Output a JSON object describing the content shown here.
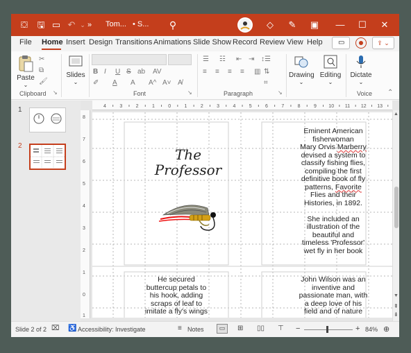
{
  "titlebar": {
    "doc_title": "Tom...",
    "save_state": "• S...",
    "more_label": "»",
    "undo_dropdown": "⌄"
  },
  "menu": {
    "tabs": [
      "File",
      "Home",
      "Insert",
      "Design",
      "Transitions",
      "Animations",
      "Slide Show",
      "Record",
      "Review",
      "View",
      "Help"
    ]
  },
  "ribbon": {
    "paste_label": "Paste",
    "slides_label": "Slides",
    "drawing_label": "Drawing",
    "editing_label": "Editing",
    "dictate_label": "Dictate",
    "groups": {
      "clipboard": "Clipboard",
      "font": "Font",
      "paragraph": "Paragraph",
      "voice": "Voice"
    },
    "font_buttons": [
      "B",
      "I",
      "U",
      "S",
      "ab",
      "AV"
    ],
    "font_size_buttons": [
      "A",
      "A",
      "A^",
      "A˅"
    ]
  },
  "ruler": {
    "labels": [
      "4",
      "3",
      "2",
      "1",
      "0",
      "1",
      "2",
      "3",
      "4",
      "5",
      "6",
      "7",
      "8",
      "9",
      "10",
      "11",
      "12",
      "13"
    ]
  },
  "thumbnails": [
    {
      "number": "1"
    },
    {
      "number": "2"
    }
  ],
  "slide": {
    "title_line1": "The",
    "title_line2": "Professor",
    "right_text_lines": [
      "Eminent American",
      "fisherwoman",
      "Mary Orvis ",
      "devised a system to",
      "classify fishing flies,",
      "compiling the first",
      "definitive book of fly",
      "patterns, ",
      "Flies and their",
      "Histories, in 1892."
    ],
    "marberry": "Marberry",
    "favorite": "Favorite",
    "right_text2_lines": [
      "She included an",
      "illustration of the",
      "beautiful and",
      "timeless 'Professor'",
      "wet fly in her book"
    ],
    "bottom_left_lines": [
      "He secured",
      "buttercup petals to",
      "his hook, adding",
      "scraps of leaf to",
      "imitate a fly's wings"
    ],
    "bottom_right_lines": [
      "John Wilson was an",
      "inventive and",
      "passionate man, with",
      "a deep love of his",
      "field and of nature"
    ]
  },
  "statusbar": {
    "slide_info": "Slide 2 of 2",
    "accessibility": "Accessibility: Investigate",
    "notes": "Notes",
    "zoom": "84%",
    "zoom_minus": "−",
    "zoom_plus": "+"
  },
  "colors": {
    "accent": "#c43e1c",
    "fly_feather": "#8a8a7a",
    "fly_body": "#d4a017"
  }
}
